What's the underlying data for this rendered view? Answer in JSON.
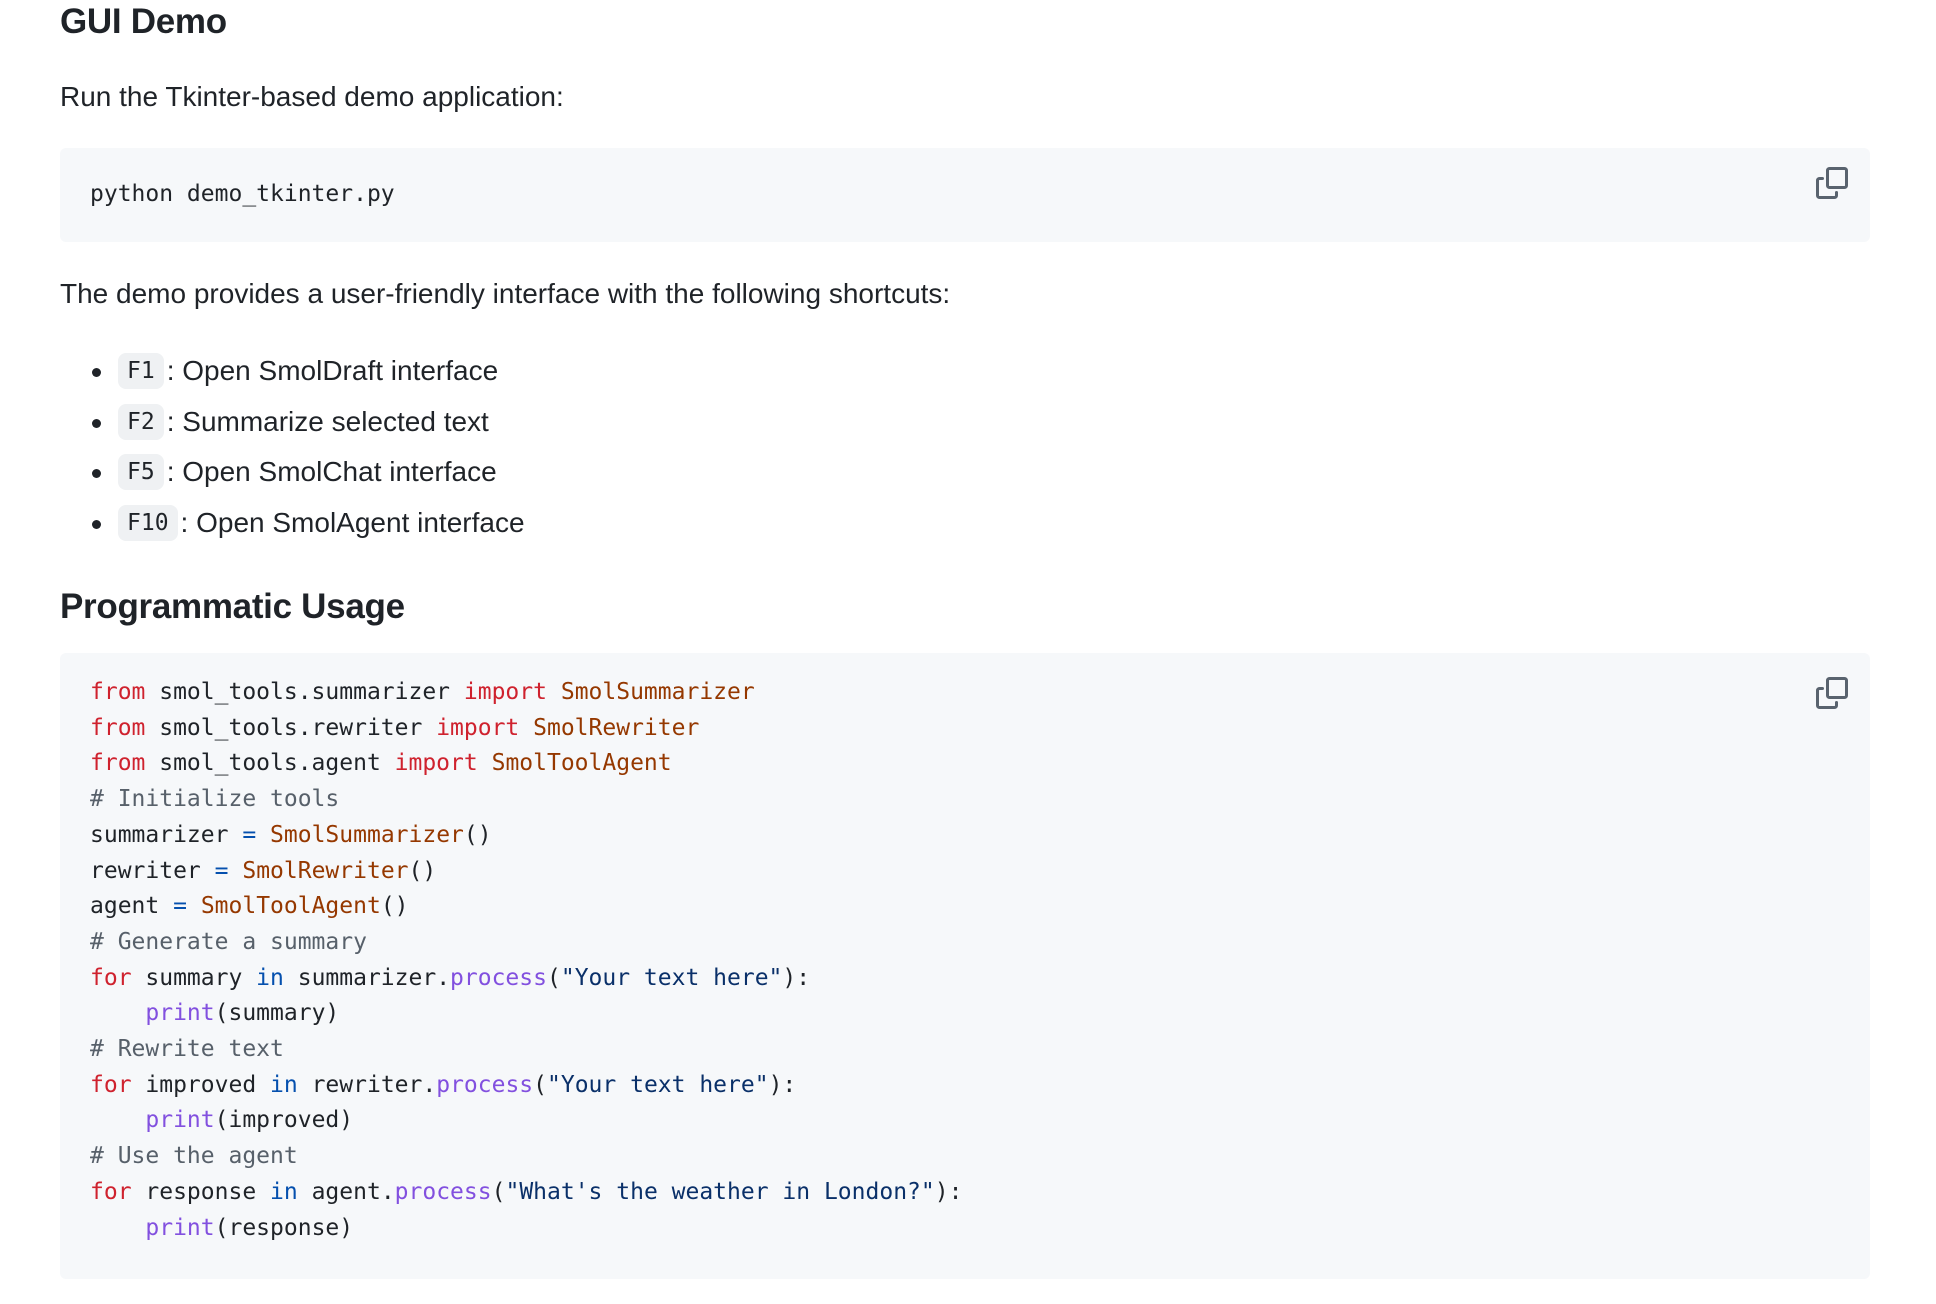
{
  "gui_demo": {
    "heading": "GUI Demo",
    "intro": "Run the Tkinter-based demo application:",
    "command": "python demo_tkinter.py",
    "copy_icon": "copy-icon",
    "shortcuts_intro": "The demo provides a user-friendly interface with the following shortcuts:",
    "shortcuts": [
      {
        "key": "F1",
        "description": ": Open SmolDraft interface"
      },
      {
        "key": "F2",
        "description": ": Summarize selected text"
      },
      {
        "key": "F5",
        "description": ": Open SmolChat interface"
      },
      {
        "key": "F10",
        "description": ": Open SmolAgent interface"
      }
    ]
  },
  "programmatic_usage": {
    "heading": "Programmatic Usage",
    "copy_icon": "copy-icon",
    "code_lines": [
      [
        {
          "t": "kw",
          "v": "from"
        },
        {
          "t": "tx",
          "v": " smol_tools.summarizer "
        },
        {
          "t": "kw",
          "v": "import"
        },
        {
          "t": "tx",
          "v": " "
        },
        {
          "t": "cls",
          "v": "SmolSummarizer"
        }
      ],
      [
        {
          "t": "kw",
          "v": "from"
        },
        {
          "t": "tx",
          "v": " smol_tools.rewriter "
        },
        {
          "t": "kw",
          "v": "import"
        },
        {
          "t": "tx",
          "v": " "
        },
        {
          "t": "cls",
          "v": "SmolRewriter"
        }
      ],
      [
        {
          "t": "kw",
          "v": "from"
        },
        {
          "t": "tx",
          "v": " smol_tools.agent "
        },
        {
          "t": "kw",
          "v": "import"
        },
        {
          "t": "tx",
          "v": " "
        },
        {
          "t": "cls",
          "v": "SmolToolAgent"
        }
      ],
      [
        {
          "t": "cm",
          "v": "# Initialize tools"
        }
      ],
      [
        {
          "t": "tx",
          "v": "summarizer "
        },
        {
          "t": "op",
          "v": "="
        },
        {
          "t": "tx",
          "v": " "
        },
        {
          "t": "cls",
          "v": "SmolSummarizer"
        },
        {
          "t": "tx",
          "v": "()"
        }
      ],
      [
        {
          "t": "tx",
          "v": "rewriter "
        },
        {
          "t": "op",
          "v": "="
        },
        {
          "t": "tx",
          "v": " "
        },
        {
          "t": "cls",
          "v": "SmolRewriter"
        },
        {
          "t": "tx",
          "v": "()"
        }
      ],
      [
        {
          "t": "tx",
          "v": "agent "
        },
        {
          "t": "op",
          "v": "="
        },
        {
          "t": "tx",
          "v": " "
        },
        {
          "t": "cls",
          "v": "SmolToolAgent"
        },
        {
          "t": "tx",
          "v": "()"
        }
      ],
      [
        {
          "t": "cm",
          "v": "# Generate a summary"
        }
      ],
      [
        {
          "t": "kw",
          "v": "for"
        },
        {
          "t": "tx",
          "v": " summary "
        },
        {
          "t": "op",
          "v": "in"
        },
        {
          "t": "tx",
          "v": " summarizer."
        },
        {
          "t": "fn",
          "v": "process"
        },
        {
          "t": "tx",
          "v": "("
        },
        {
          "t": "str",
          "v": "\"Your text here\""
        },
        {
          "t": "tx",
          "v": "):"
        }
      ],
      [
        {
          "t": "tx",
          "v": "    "
        },
        {
          "t": "fn",
          "v": "print"
        },
        {
          "t": "tx",
          "v": "(summary)"
        }
      ],
      [
        {
          "t": "cm",
          "v": "# Rewrite text"
        }
      ],
      [
        {
          "t": "kw",
          "v": "for"
        },
        {
          "t": "tx",
          "v": " improved "
        },
        {
          "t": "op",
          "v": "in"
        },
        {
          "t": "tx",
          "v": " rewriter."
        },
        {
          "t": "fn",
          "v": "process"
        },
        {
          "t": "tx",
          "v": "("
        },
        {
          "t": "str",
          "v": "\"Your text here\""
        },
        {
          "t": "tx",
          "v": "):"
        }
      ],
      [
        {
          "t": "tx",
          "v": "    "
        },
        {
          "t": "fn",
          "v": "print"
        },
        {
          "t": "tx",
          "v": "(improved)"
        }
      ],
      [
        {
          "t": "cm",
          "v": "# Use the agent"
        }
      ],
      [
        {
          "t": "kw",
          "v": "for"
        },
        {
          "t": "tx",
          "v": " response "
        },
        {
          "t": "op",
          "v": "in"
        },
        {
          "t": "tx",
          "v": " agent."
        },
        {
          "t": "fn",
          "v": "process"
        },
        {
          "t": "tx",
          "v": "("
        },
        {
          "t": "str",
          "v": "\"What's the weather in London?\""
        },
        {
          "t": "tx",
          "v": "):"
        }
      ],
      [
        {
          "t": "tx",
          "v": "    "
        },
        {
          "t": "fn",
          "v": "print"
        },
        {
          "t": "tx",
          "v": "(response)"
        }
      ]
    ]
  },
  "colors": {
    "text": "#1f2328",
    "code_background": "#f6f8fa",
    "inline_code_background": "#eff1f3",
    "keyword": "#cf222e",
    "class_name": "#953800",
    "operator": "#0550ae",
    "function": "#8250df",
    "string": "#0a3069",
    "comment": "#57606a",
    "icon": "#59636e"
  }
}
